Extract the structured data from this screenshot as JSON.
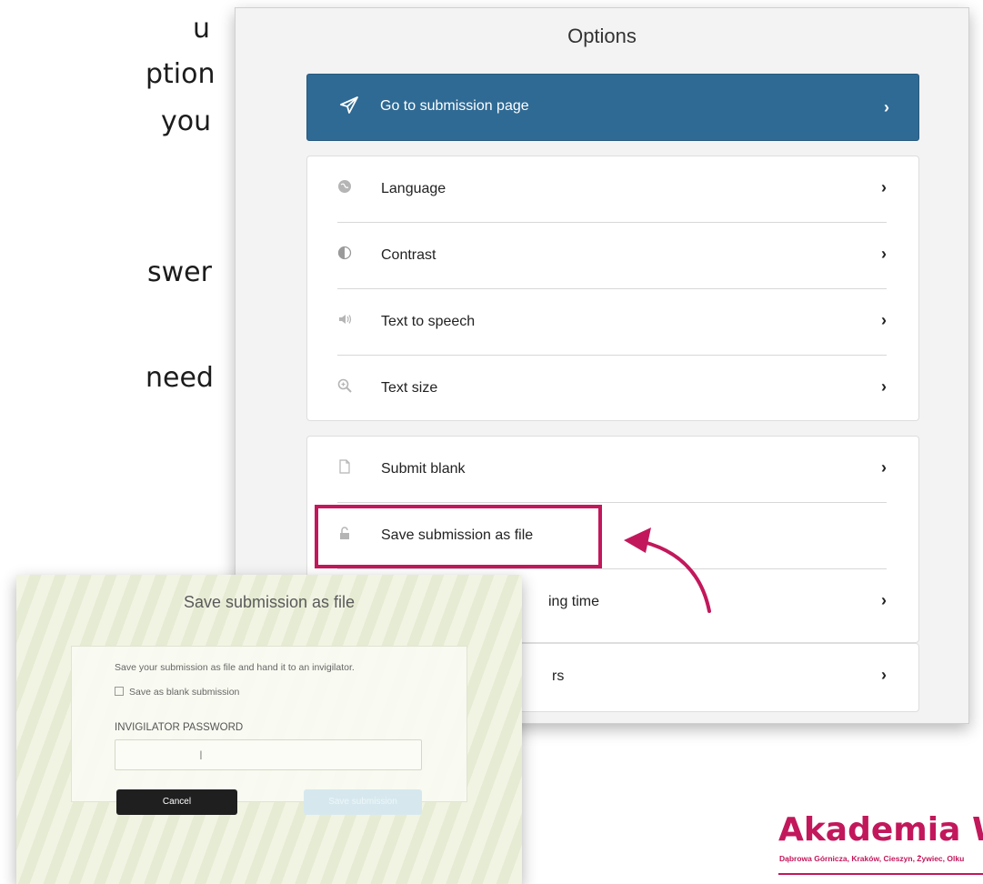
{
  "slide": {
    "lines": [
      "u",
      "ption",
      "you",
      "swer",
      "need"
    ],
    "stray": "."
  },
  "options": {
    "title": "Options",
    "submit": {
      "label": "Go to submission page",
      "icon": "paper-plane-icon"
    },
    "group1": [
      {
        "label": "Language",
        "icon": "globe-icon"
      },
      {
        "label": "Contrast",
        "icon": "contrast-icon"
      },
      {
        "label": "Text to speech",
        "icon": "speaker-icon"
      },
      {
        "label": "Text size",
        "icon": "zoom-icon"
      }
    ],
    "group2": [
      {
        "label": "Submit blank",
        "icon": "document-icon"
      },
      {
        "label": "Save submission as file",
        "icon": "unlock-icon"
      },
      {
        "label": "ing time",
        "icon": ""
      }
    ],
    "group3": [
      {
        "label": "rs",
        "icon": ""
      }
    ]
  },
  "dialog": {
    "title": "Save submission as file",
    "message": "Save your submission as file and hand it to an invigilator.",
    "checkbox_label": "Save as blank submission",
    "password_label": "INVIGILATOR PASSWORD",
    "cancel_label": "Cancel",
    "save_label": "Save submission"
  },
  "logo": {
    "title": "Akademia W",
    "subtitle": "Dąbrowa Górnicza, Kraków, Cieszyn, Żywiec, Olku"
  },
  "colors": {
    "accent": "#c2185b",
    "submit_bar": "#2f6a94"
  }
}
